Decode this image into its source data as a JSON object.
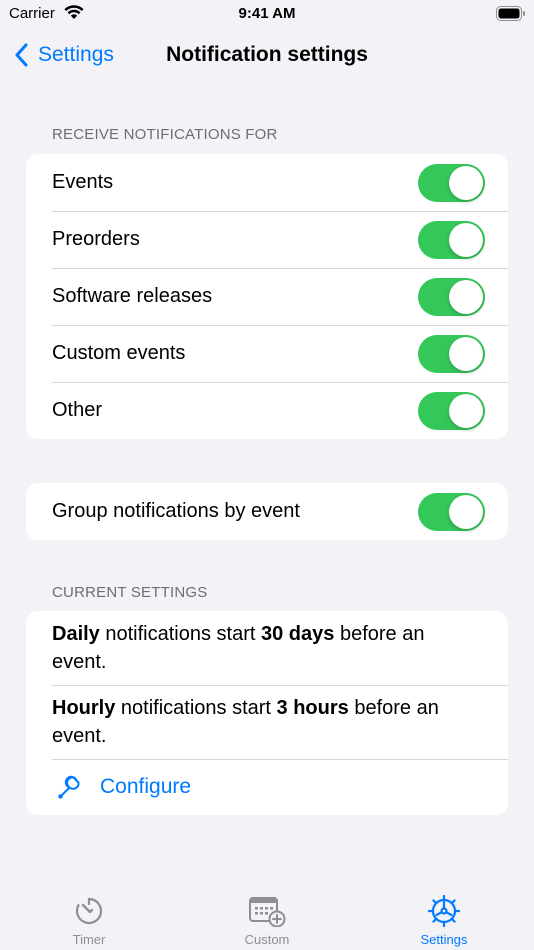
{
  "status_bar": {
    "carrier": "Carrier",
    "time": "9:41 AM"
  },
  "nav": {
    "back_label": "Settings",
    "title": "Notification settings"
  },
  "receive_section": {
    "header": "RECEIVE NOTIFICATIONS FOR",
    "items": [
      {
        "label": "Events",
        "on": true
      },
      {
        "label": "Preorders",
        "on": true
      },
      {
        "label": "Software releases",
        "on": true
      },
      {
        "label": "Custom events",
        "on": true
      },
      {
        "label": "Other",
        "on": true
      }
    ]
  },
  "group_section": {
    "label": "Group notifications by event",
    "on": true
  },
  "current_section": {
    "header": "CURRENT SETTINGS",
    "daily": {
      "bold1": "Daily",
      "mid": " notifications start ",
      "bold2": "30 days",
      "rest": " before an event."
    },
    "hourly": {
      "bold1": "Hourly",
      "mid": " notifications start ",
      "bold2": "3 hours",
      "rest": " before an event."
    },
    "configure_label": "Configure",
    "configure_icon": "wrench-icon"
  },
  "tab_bar": {
    "tabs": [
      {
        "label": "Timer",
        "icon": "timer-icon"
      },
      {
        "label": "Custom",
        "icon": "calendar-add-icon"
      },
      {
        "label": "Settings",
        "icon": "gear-icon",
        "active": true
      }
    ]
  },
  "colors": {
    "accent": "#007aff",
    "toggle_on": "#34c759",
    "background": "#f2f2f7"
  }
}
